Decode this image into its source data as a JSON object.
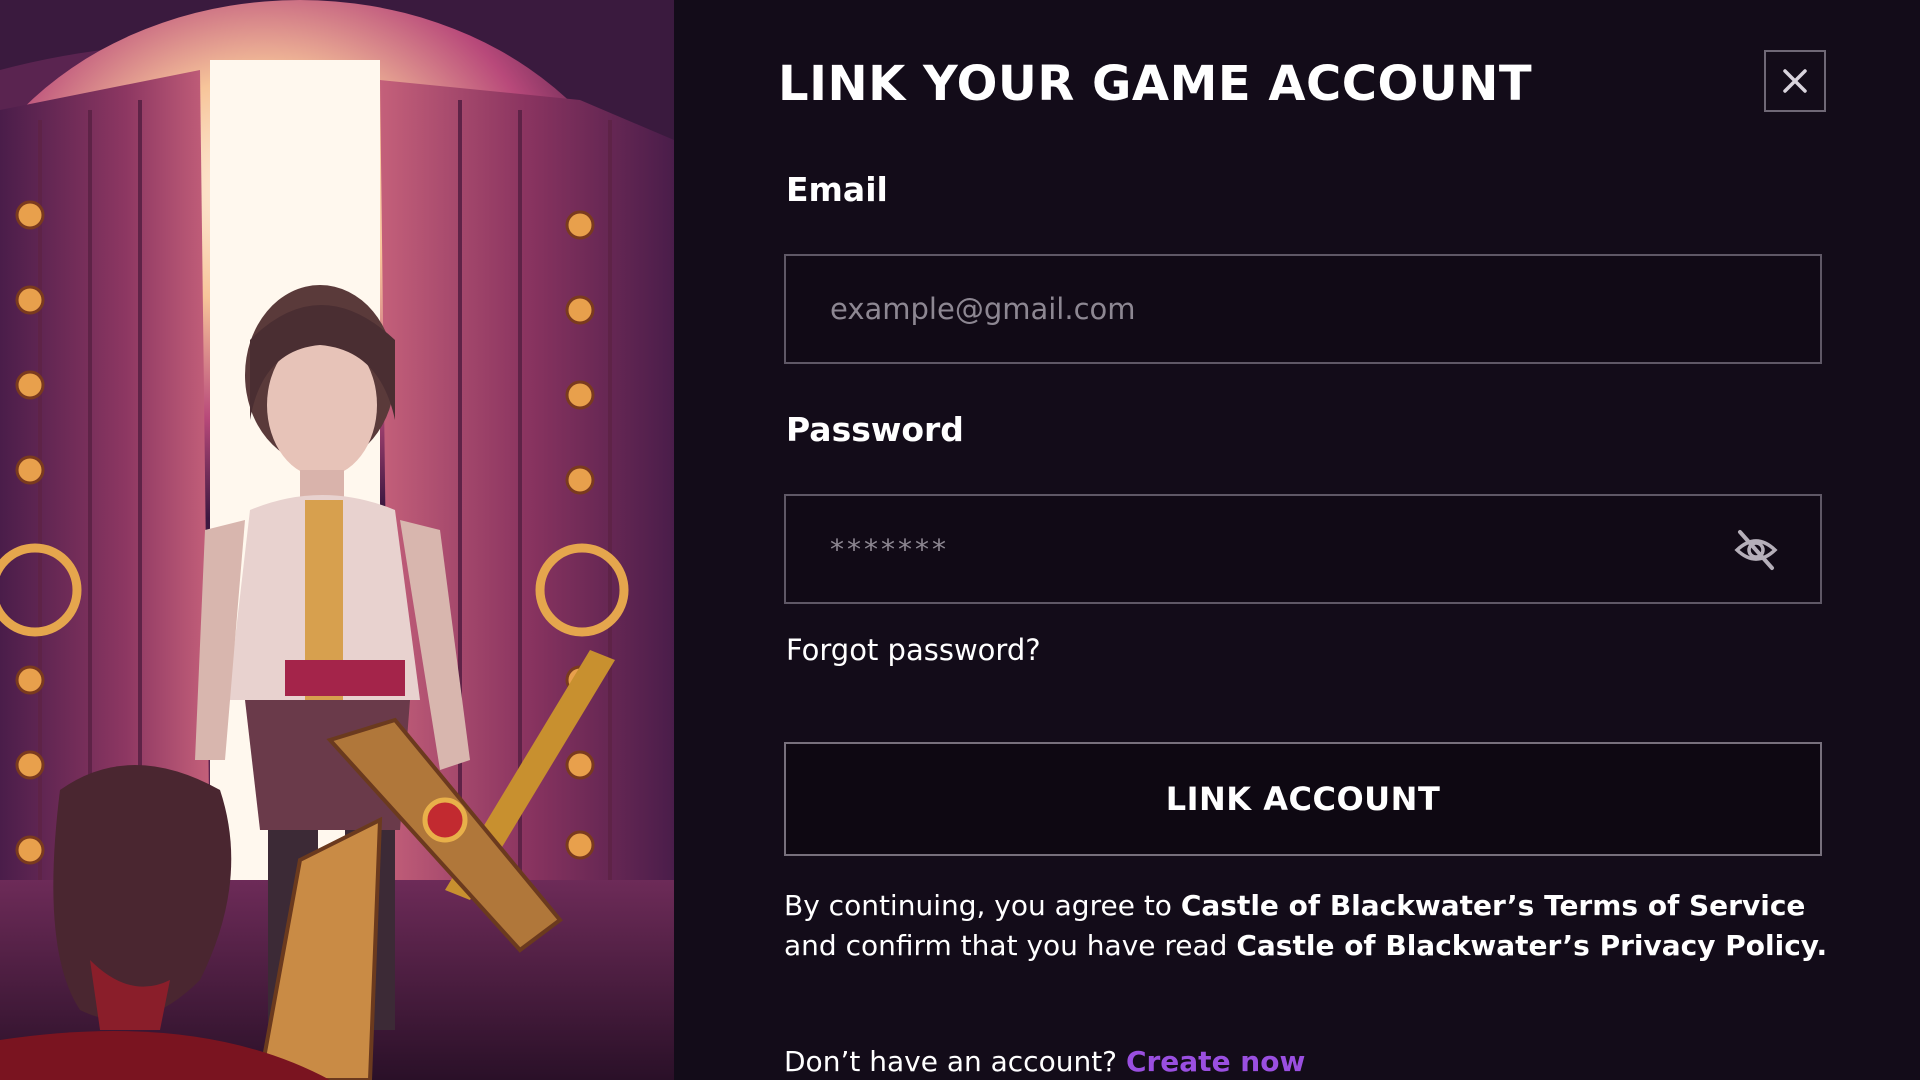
{
  "colors": {
    "panel_background": "#130c19",
    "accent_link": "#9a4fe0",
    "text": "#ffffff",
    "border": "#5f5866"
  },
  "illustration": {
    "description_icon": "castle-gate-warrior-artwork"
  },
  "dialog": {
    "title": "LINK YOUR GAME ACCOUNT",
    "close_icon": "close-icon",
    "email": {
      "label": "Email",
      "value": "",
      "placeholder": "example@gmail.com"
    },
    "password": {
      "label": "Password",
      "value": "",
      "placeholder": "*******",
      "toggle_icon": "eye-slash-icon"
    },
    "forgot_password": "Forgot password?",
    "submit_label": "LINK ACCOUNT",
    "terms": {
      "prefix": "By continuing, you agree to ",
      "terms_link": "Castle of Blackwater’s Terms of Service",
      "middle": " and confirm that you have read ",
      "privacy_link": "Castle of Blackwater’s Privacy Policy."
    },
    "signup": {
      "prompt": "Don’t have an account? ",
      "link": "Create now"
    }
  }
}
